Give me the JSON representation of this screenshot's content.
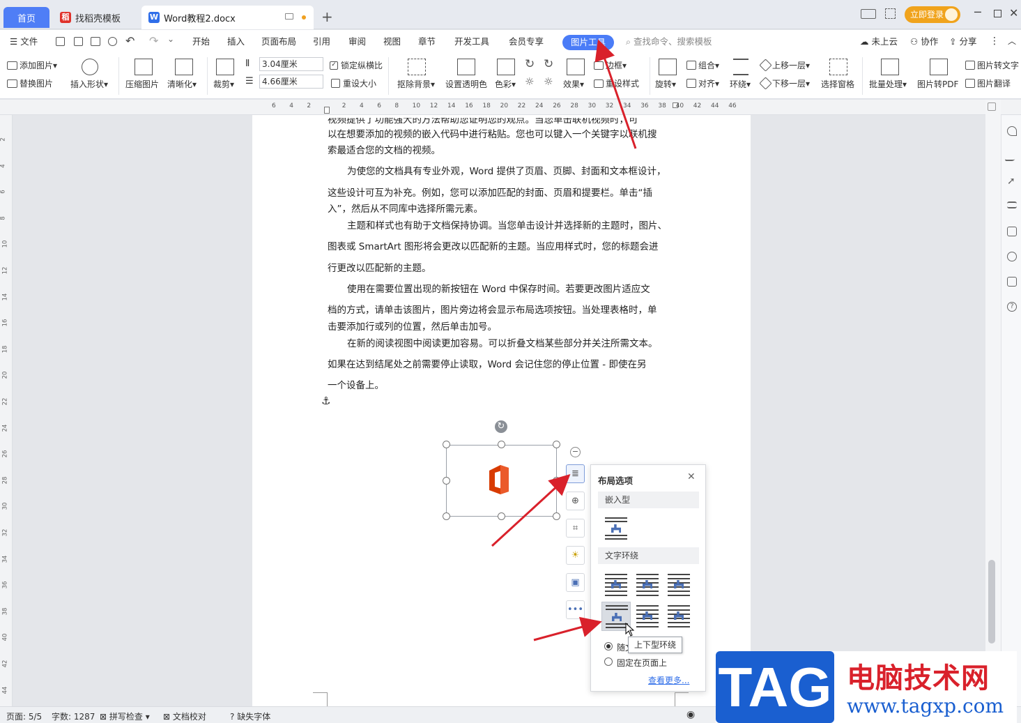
{
  "tabs": {
    "home": "首页",
    "templates": "找稻壳模板",
    "doc": "Word教程2.docx",
    "login": "立即登录"
  },
  "menu": {
    "file": "文件",
    "items": [
      "开始",
      "插入",
      "页面布局",
      "引用",
      "审阅",
      "视图",
      "章节",
      "开发工具",
      "会员专享"
    ],
    "picture_tools": "图片工具",
    "search_placeholder": "查找命令、搜索模板",
    "cloud": "未上云",
    "collab": "协作",
    "share": "分享"
  },
  "ribbon": {
    "add_picture": "添加图片",
    "replace_picture": "替换图片",
    "insert_shape": "插入形状",
    "compress": "压缩图片",
    "sharpen": "清晰化",
    "crop": "裁剪",
    "height_value": "3.04厘米",
    "width_value": "4.66厘米",
    "lock_ratio": "锁定纵横比",
    "reset_size": "重设大小",
    "remove_bg": "抠除背景",
    "set_transparent": "设置透明色",
    "color": "色彩",
    "effects": "效果",
    "border": "边框",
    "reset_style": "重设样式",
    "rotate": "旋转",
    "group": "组合",
    "align": "对齐",
    "wrap": "环绕",
    "bring_forward": "上移一层",
    "send_backward": "下移一层",
    "selection_pane": "选择窗格",
    "batch": "批量处理",
    "to_pdf": "图片转PDF",
    "to_text": "图片转文字",
    "translate": "图片翻译"
  },
  "ruler_ticks": [
    "6",
    "4",
    "2",
    "",
    "2",
    "4",
    "6",
    "8",
    "10",
    "12",
    "14",
    "16",
    "18",
    "20",
    "22",
    "24",
    "26",
    "28",
    "30",
    "32",
    "34",
    "36",
    "38",
    "40",
    "42",
    "44",
    "46"
  ],
  "vruler_ticks": [
    "2",
    "4",
    "6",
    "8",
    "10",
    "12",
    "14",
    "16",
    "18",
    "20",
    "22",
    "24",
    "26",
    "28",
    "30",
    "32",
    "34",
    "36",
    "38",
    "40",
    "42",
    "44"
  ],
  "document": {
    "lines": [
      "视频提供了功能强大的方法帮助您证明您的观点。当您单击联机视频时，可",
      "以在想要添加的视频的嵌入代码中进行粘贴。您也可以键入一个关键字以联机搜",
      "索最适合您的文档的视频。",
      "为使您的文档具有专业外观，Word 提供了页眉、页脚、封面和文本框设计，",
      "这些设计可互为补充。例如，您可以添加匹配的封面、页眉和提要栏。单击“插",
      "入”，然后从不同库中选择所需元素。",
      "主题和样式也有助于文档保持协调。当您单击设计并选择新的主题时，图片、",
      "图表或 SmartArt 图形将会更改以匹配新的主题。当应用样式时，您的标题会进",
      "行更改以匹配新的主题。",
      "使用在需要位置出现的新按钮在 Word 中保存时间。若要更改图片适应文",
      "档的方式，请单击该图片，图片旁边将会显示布局选项按钮。当处理表格时，单",
      "击要添加行或列的位置，然后单击加号。",
      "在新的阅读视图中阅读更加容易。可以折叠文档某些部分并关注所需文本。",
      "如果在达到结尾处之前需要停止读取，Word 会记住您的停止位置 - 即使在另",
      "一个设备上。"
    ]
  },
  "layout_options": {
    "title": "布局选项",
    "inline_section": "嵌入型",
    "wrap_section": "文字环绕",
    "radio_move": "随文字移动",
    "radio_fixed": "固定在页面上",
    "more": "查看更多...",
    "tooltip": "上下型环绕"
  },
  "status": {
    "page": "页面: 5/5",
    "words": "字数: 1287",
    "spell": "拼写检查",
    "proof": "文档校对",
    "missing_font": "缺失字体"
  },
  "watermark": {
    "tag": "TAG",
    "site_name": "电脑技术网",
    "url": "www.tagxp.com"
  },
  "colors": {
    "accent": "#4a7cf7",
    "arrow": "#d9212b",
    "office_logo": "#d83b01"
  }
}
